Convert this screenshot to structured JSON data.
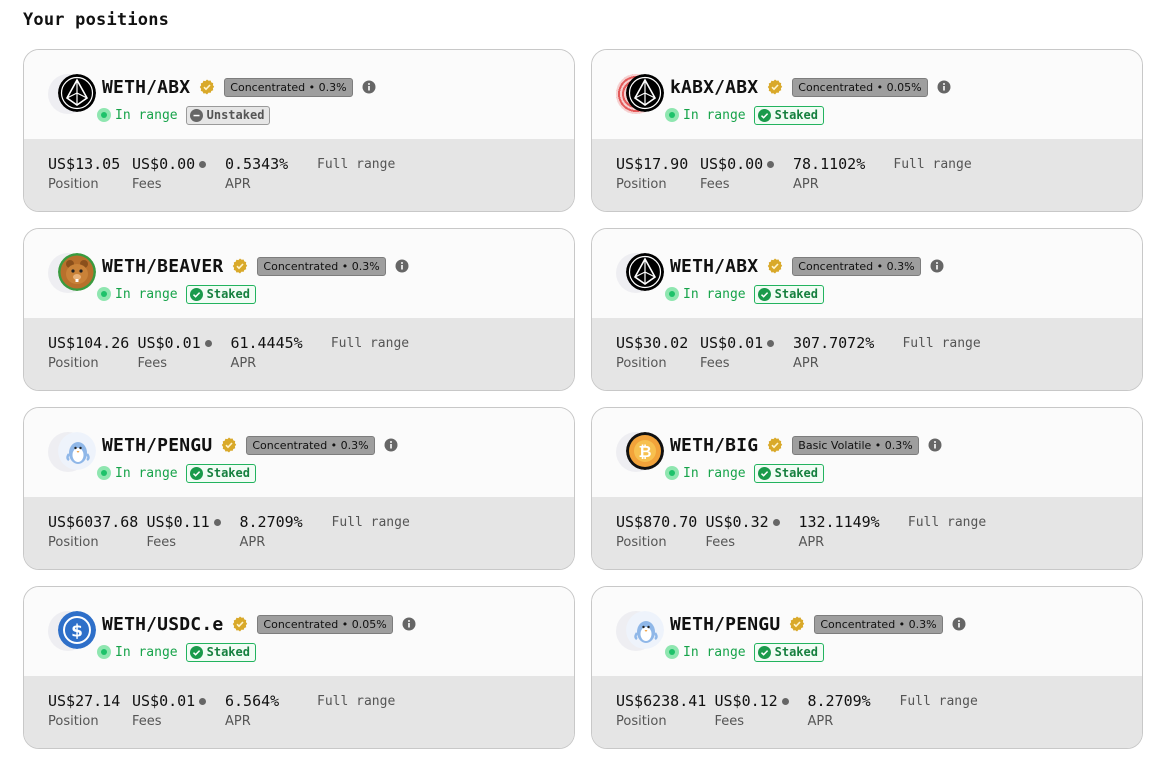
{
  "page": {
    "title": "Your positions"
  },
  "labels": {
    "position": "Position",
    "fees": "Fees",
    "apr": "APR"
  },
  "positions": [
    {
      "pair": "WETH/ABX",
      "logo": "abx-logo",
      "pool": "Concentrated • 0.3%",
      "range": "In range",
      "stake": "Unstaked",
      "staked": false,
      "position": "US$13.05",
      "fees": "US$0.00",
      "apr": "0.5343%",
      "range_type": "Full range"
    },
    {
      "pair": "kABX/ABX",
      "logo": "kabx-abx-logo",
      "pool": "Concentrated • 0.05%",
      "range": "In range",
      "stake": "Staked",
      "staked": true,
      "position": "US$17.90",
      "fees": "US$0.00",
      "apr": "78.1102%",
      "range_type": "Full range"
    },
    {
      "pair": "WETH/BEAVER",
      "logo": "beaver-logo",
      "pool": "Concentrated • 0.3%",
      "range": "In range",
      "stake": "Staked",
      "staked": true,
      "position": "US$104.26",
      "fees": "US$0.01",
      "apr": "61.4445%",
      "range_type": "Full range"
    },
    {
      "pair": "WETH/ABX",
      "logo": "abx-logo",
      "pool": "Concentrated • 0.3%",
      "range": "In range",
      "stake": "Staked",
      "staked": true,
      "position": "US$30.02",
      "fees": "US$0.01",
      "apr": "307.7072%",
      "range_type": "Full range"
    },
    {
      "pair": "WETH/PENGU",
      "logo": "pengu-logo",
      "pool": "Concentrated • 0.3%",
      "range": "In range",
      "stake": "Staked",
      "staked": true,
      "position": "US$6037.68",
      "fees": "US$0.11",
      "apr": "8.2709%",
      "range_type": "Full range"
    },
    {
      "pair": "WETH/BIG",
      "logo": "big-logo",
      "pool": "Basic Volatile • 0.3%",
      "range": "In range",
      "stake": "Staked",
      "staked": true,
      "position": "US$870.70",
      "fees": "US$0.32",
      "apr": "132.1149%",
      "range_type": "Full range"
    },
    {
      "pair": "WETH/USDC.e",
      "logo": "usdc-logo",
      "pool": "Concentrated • 0.05%",
      "range": "In range",
      "stake": "Staked",
      "staked": true,
      "position": "US$27.14",
      "fees": "US$0.01",
      "apr": "6.564%",
      "range_type": "Full range"
    },
    {
      "pair": "WETH/PENGU",
      "logo": "pengu-logo",
      "pool": "Concentrated • 0.3%",
      "range": "In range",
      "stake": "Staked",
      "staked": true,
      "position": "US$6238.41",
      "fees": "US$0.12",
      "apr": "8.2709%",
      "range_type": "Full range"
    }
  ],
  "colors": {
    "in_range_green": "#17a34a",
    "staked_green": "#22b35e",
    "pool_badge_gray": "#9e9e9e",
    "verified_gold": "#d9a92a"
  }
}
